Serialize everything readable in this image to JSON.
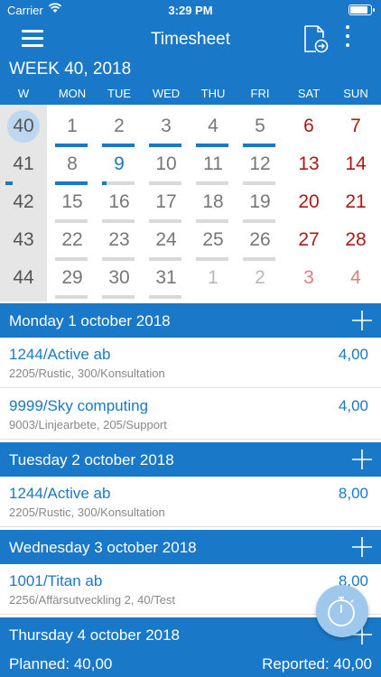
{
  "status": {
    "carrier": "Carrier",
    "time": "3:29 PM"
  },
  "nav": {
    "title": "Timesheet",
    "menu_icon": "hamburger-menu-icon",
    "export_icon": "export-document-icon",
    "more_icon": "more-vertical-icon"
  },
  "week_label": "WEEK 40, 2018",
  "day_headers": [
    "W",
    "MON",
    "TUE",
    "WED",
    "THU",
    "FRI",
    "SAT",
    "SUN"
  ],
  "calendar": {
    "rows": [
      {
        "week": "40",
        "days": [
          "1",
          "2",
          "3",
          "4",
          "5",
          "6",
          "7"
        ]
      },
      {
        "week": "41",
        "days": [
          "8",
          "9",
          "10",
          "11",
          "12",
          "13",
          "14"
        ]
      },
      {
        "week": "42",
        "days": [
          "15",
          "16",
          "17",
          "18",
          "19",
          "20",
          "21"
        ]
      },
      {
        "week": "43",
        "days": [
          "22",
          "23",
          "24",
          "25",
          "26",
          "27",
          "28"
        ]
      },
      {
        "week": "44",
        "days": [
          "29",
          "30",
          "31",
          "1",
          "2",
          "3",
          "4"
        ]
      }
    ],
    "selected_week": "40",
    "today": "9",
    "day_progress": {
      "1": 1.0,
      "2": 1.0,
      "3": 1.0,
      "4": 1.0,
      "5": 1.0,
      "8": 1.0,
      "9": 0.15
    },
    "week_progress": {
      "41": 0.2
    }
  },
  "days": [
    {
      "label": "Monday 1 october 2018",
      "entries": [
        {
          "name": "1244/Active ab",
          "hours": "4,00",
          "sub": "2205/Rustic, 300/Konsultation"
        },
        {
          "name": "9999/Sky computing",
          "hours": "4,00",
          "sub": "9003/Linjearbete, 205/Support"
        }
      ]
    },
    {
      "label": "Tuesday 2 october 2018",
      "entries": [
        {
          "name": "1244/Active ab",
          "hours": "8,00",
          "sub": "2205/Rustic, 300/Konsultation"
        }
      ]
    },
    {
      "label": "Wednesday 3 october 2018",
      "entries": [
        {
          "name": "1001/Titan ab",
          "hours": "8,00",
          "sub": "2256/Affärsutveckling 2, 40/Test"
        }
      ]
    },
    {
      "label": "Thursday 4 october 2018",
      "entries": []
    }
  ],
  "footer": {
    "planned": "Planned: 40,00",
    "reported": "Reported: 40,00"
  },
  "fab": {
    "icon": "stopwatch-icon"
  },
  "colors": {
    "primary": "#1a78c8",
    "weekend": "#b01818",
    "muted": "#b8b8b8"
  }
}
